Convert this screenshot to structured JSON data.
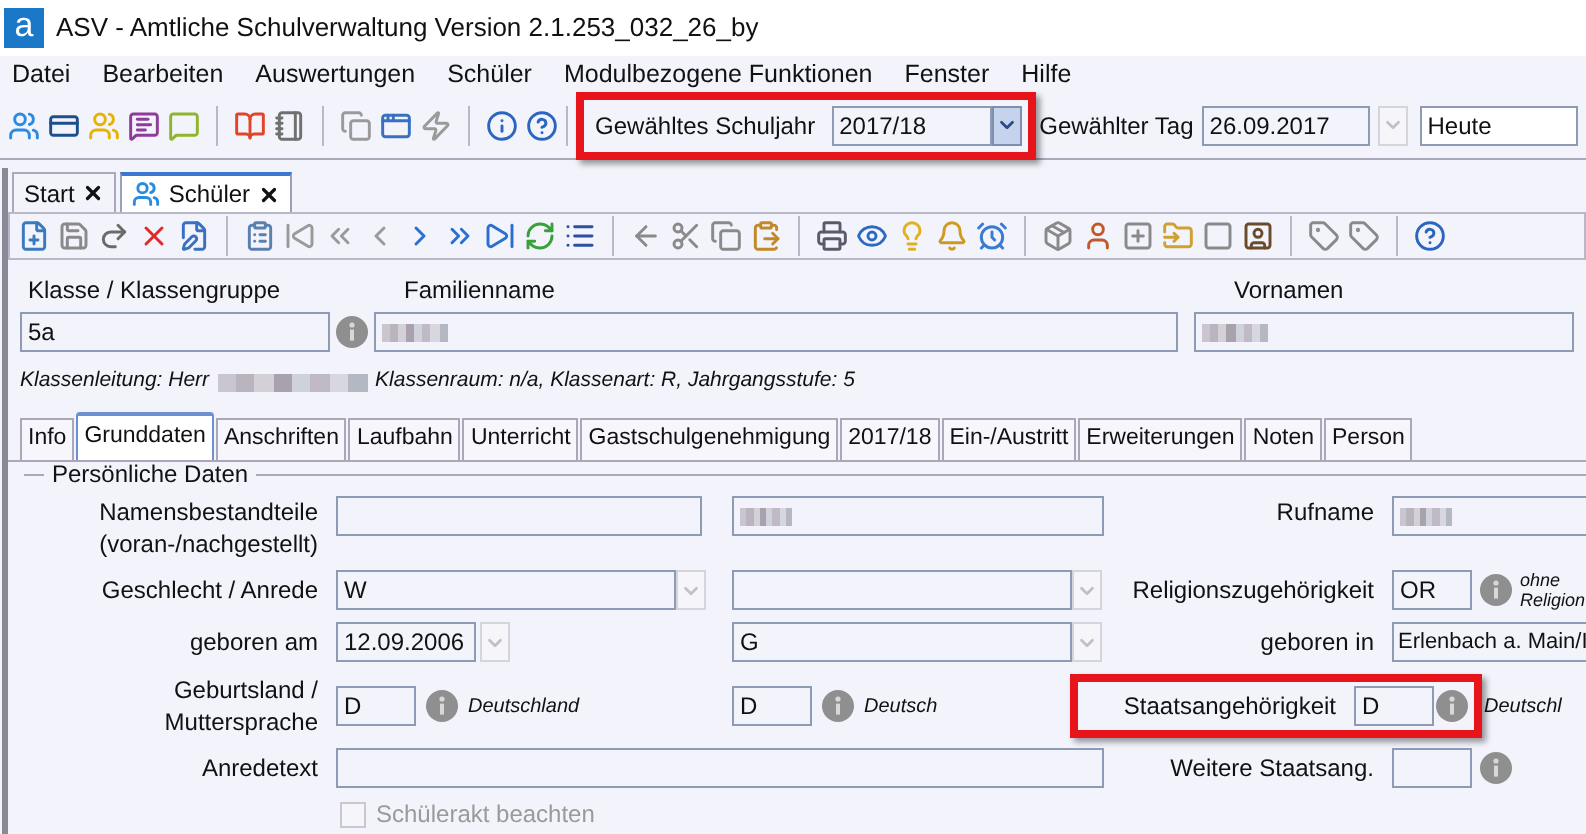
{
  "window": {
    "logo": "a",
    "title": "ASV - Amtliche Schulverwaltung Version 2.1.253_032_26_by"
  },
  "menu": [
    {
      "label": "Datei"
    },
    {
      "label": "Bearbeiten"
    },
    {
      "label": "Auswertungen"
    },
    {
      "label": "Schüler"
    },
    {
      "label": "Modulbezogene Funktionen"
    },
    {
      "label": "Fenster"
    },
    {
      "label": "Hilfe"
    }
  ],
  "toolbar": {
    "school_year": {
      "label": "Gewähltes Schuljahr",
      "value": "2017/18",
      "highlighted": true
    },
    "day": {
      "label": "Gewählter Tag",
      "value": "26.09.2017"
    },
    "day_mode": {
      "value": "Heute"
    }
  },
  "doc_tabs": [
    {
      "label": "Start",
      "selected": false
    },
    {
      "label": "Schüler",
      "selected": true
    }
  ],
  "header": {
    "class": {
      "label": "Klasse / Klassengruppe",
      "value": "5a"
    },
    "family_name": {
      "label": "Familienname",
      "redacted": true
    },
    "first_names": {
      "label": "Vornamen",
      "redacted": true
    },
    "info_prefix": "Klassenleitung: Herr",
    "info_rest": "Klassenraum: n/a, Klassenart: R, Jahrgangsstufe: 5"
  },
  "form_tabs": [
    {
      "label": "Info",
      "selected": false
    },
    {
      "label": "Grunddaten",
      "selected": true
    },
    {
      "label": "Anschriften",
      "selected": false
    },
    {
      "label": "Laufbahn",
      "selected": false
    },
    {
      "label": "Unterricht",
      "selected": false
    },
    {
      "label": "Gastschulgenehmigung",
      "selected": false
    },
    {
      "label": "2017/18",
      "selected": false
    },
    {
      "label": "Ein-/Austritt",
      "selected": false
    },
    {
      "label": "Erweiterungen",
      "selected": false
    },
    {
      "label": "Noten",
      "selected": false
    },
    {
      "label": "Person",
      "selected": false
    }
  ],
  "section": {
    "title": "Persönliche Daten"
  },
  "personal": {
    "name_parts": {
      "label": "Namensbestandteile (voran-/nachgestellt)",
      "value_2_redacted": true
    },
    "call_name": {
      "label": "Rufname",
      "redacted": true
    },
    "gender": {
      "label": "Geschlecht / Anrede",
      "value": "W"
    },
    "religion": {
      "label": "Religionszugehörigkeit",
      "value": "OR",
      "note": "ohne Religion"
    },
    "birth_date": {
      "label": "geboren am",
      "value": "12.09.2006",
      "value_2": "G"
    },
    "birth_place": {
      "label": "geboren in",
      "value": "Erlenbach a. Main/I"
    },
    "birth_country": {
      "label": "Geburtsland / Muttersprache",
      "value": "D",
      "note": "Deutschland",
      "value_2": "D",
      "note_2": "Deutsch"
    },
    "nationality": {
      "label": "Staatsangehörigkeit",
      "value": "D",
      "note": "Deutschl",
      "highlighted": true
    },
    "salutation": {
      "label": "Anredetext"
    },
    "other_nationality": {
      "label": "Weitere Staatsang."
    },
    "student_file": {
      "label": "Schülerakt beachten",
      "checked": false,
      "disabled": true
    }
  }
}
